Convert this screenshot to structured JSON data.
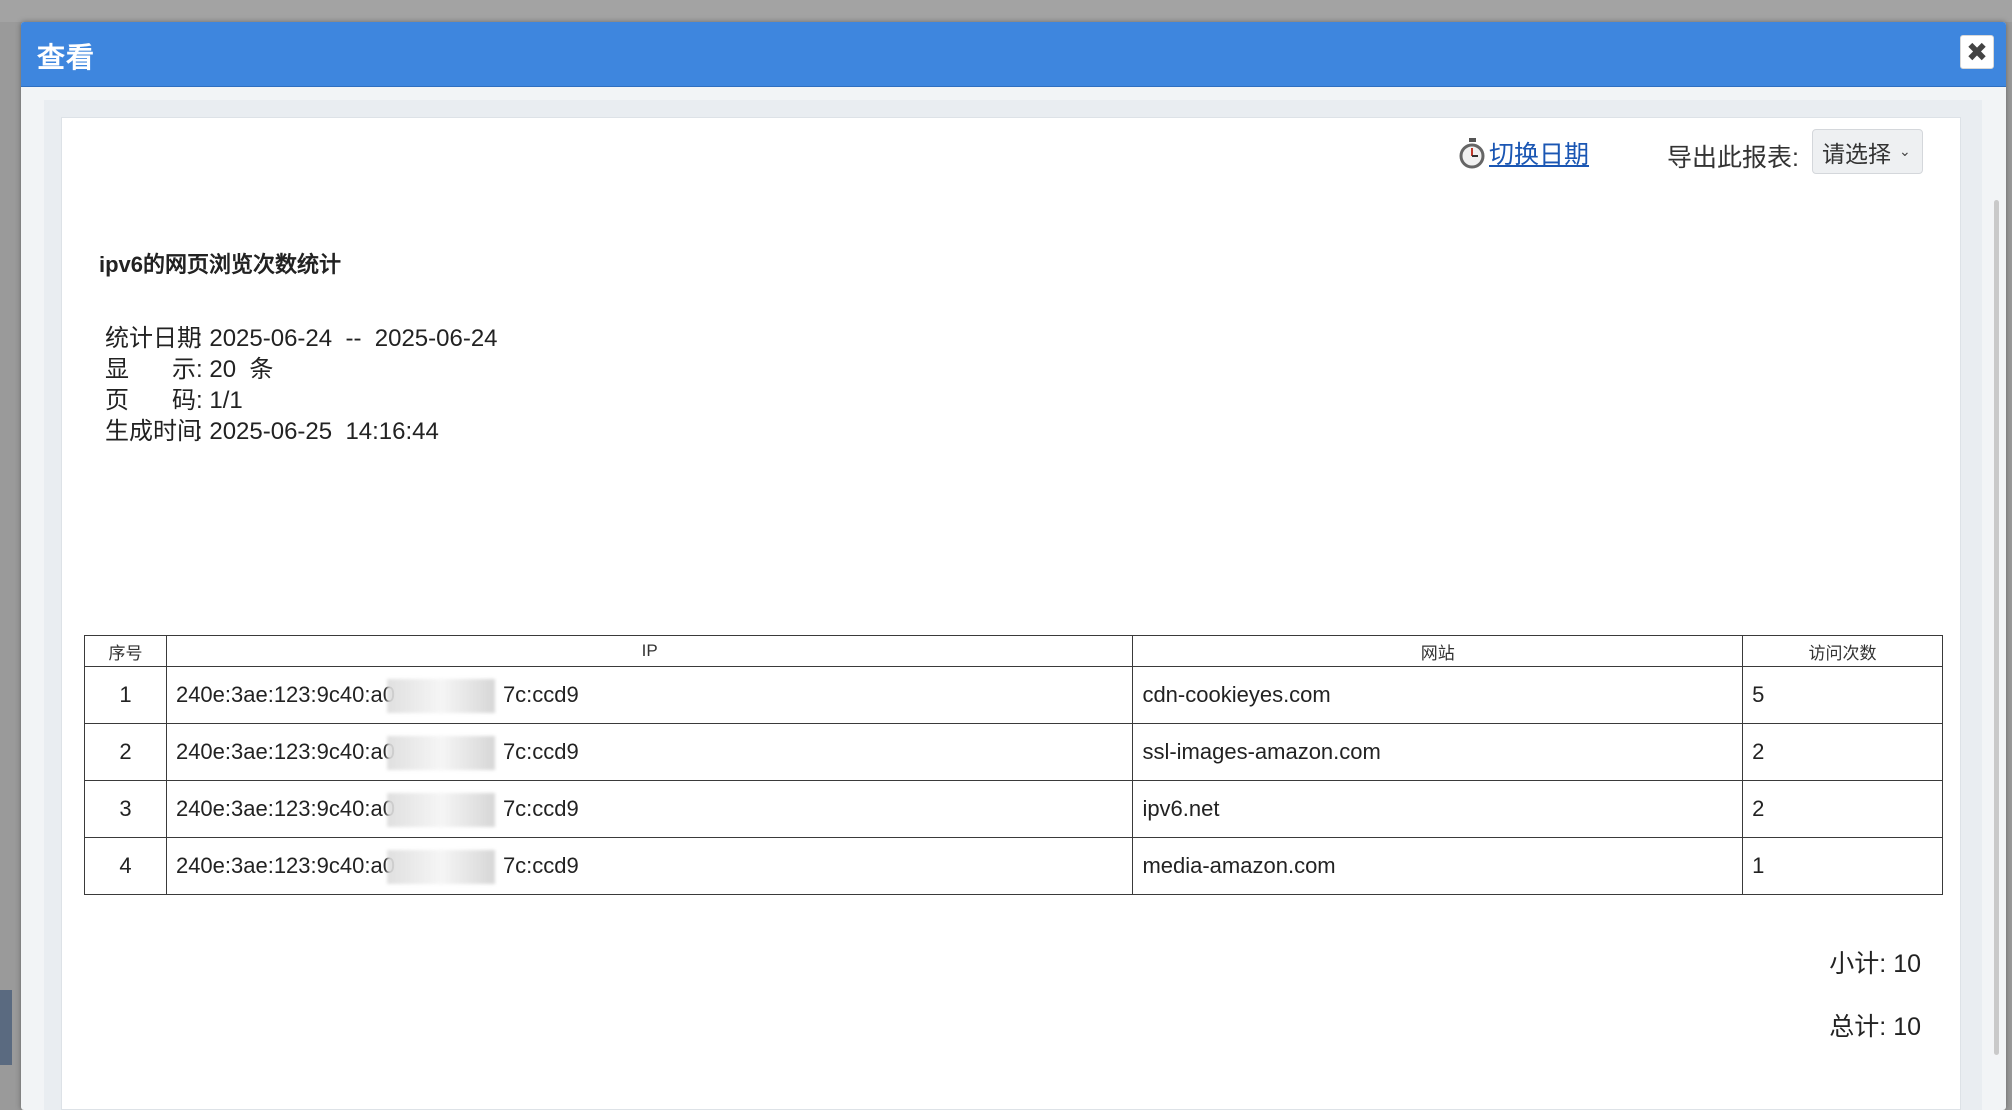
{
  "dialog": {
    "title": "查看",
    "close_glyph": "✖"
  },
  "toolbar": {
    "switch_date": "切换日期",
    "export_label": "导出此报表:",
    "export_select": "请选择"
  },
  "report": {
    "title": "ipv6的网页浏览次数统计",
    "meta": [
      {
        "label": "统计日期",
        "value": "2025-06-24  --  2025-06-24"
      },
      {
        "label": "显示",
        "value": "20  条"
      },
      {
        "label": "页码",
        "value": "1/1"
      },
      {
        "label": "生成时间",
        "value": "2025-06-25  14:16:44"
      }
    ],
    "columns": [
      "序号",
      "IP",
      "网站",
      "访问次数"
    ],
    "rows": [
      {
        "no": "1",
        "ip_prefix": "240e:3ae:123:9c40:a0",
        "ip_suffix": "7c:ccd9",
        "site": "cdn-cookieyes.com",
        "count": "5"
      },
      {
        "no": "2",
        "ip_prefix": "240e:3ae:123:9c40:a0",
        "ip_suffix": "7c:ccd9",
        "site": "ssl-images-amazon.com",
        "count": "2"
      },
      {
        "no": "3",
        "ip_prefix": "240e:3ae:123:9c40:a0",
        "ip_suffix": "7c:ccd9",
        "site": "ipv6.net",
        "count": "2"
      },
      {
        "no": "4",
        "ip_prefix": "240e:3ae:123:9c40:a0",
        "ip_suffix": "7c:ccd9",
        "site": "media-amazon.com",
        "count": "1"
      }
    ],
    "subtotal_label": "小计:",
    "subtotal_value": "10",
    "total_label": "总计:",
    "total_value": "10"
  },
  "colors": {
    "header_blue": "#3e86de",
    "link_blue": "#1a56b3"
  },
  "icons": {
    "switch_date": "stopwatch-icon",
    "close": "close-icon",
    "select": "chevron-down-icon"
  }
}
